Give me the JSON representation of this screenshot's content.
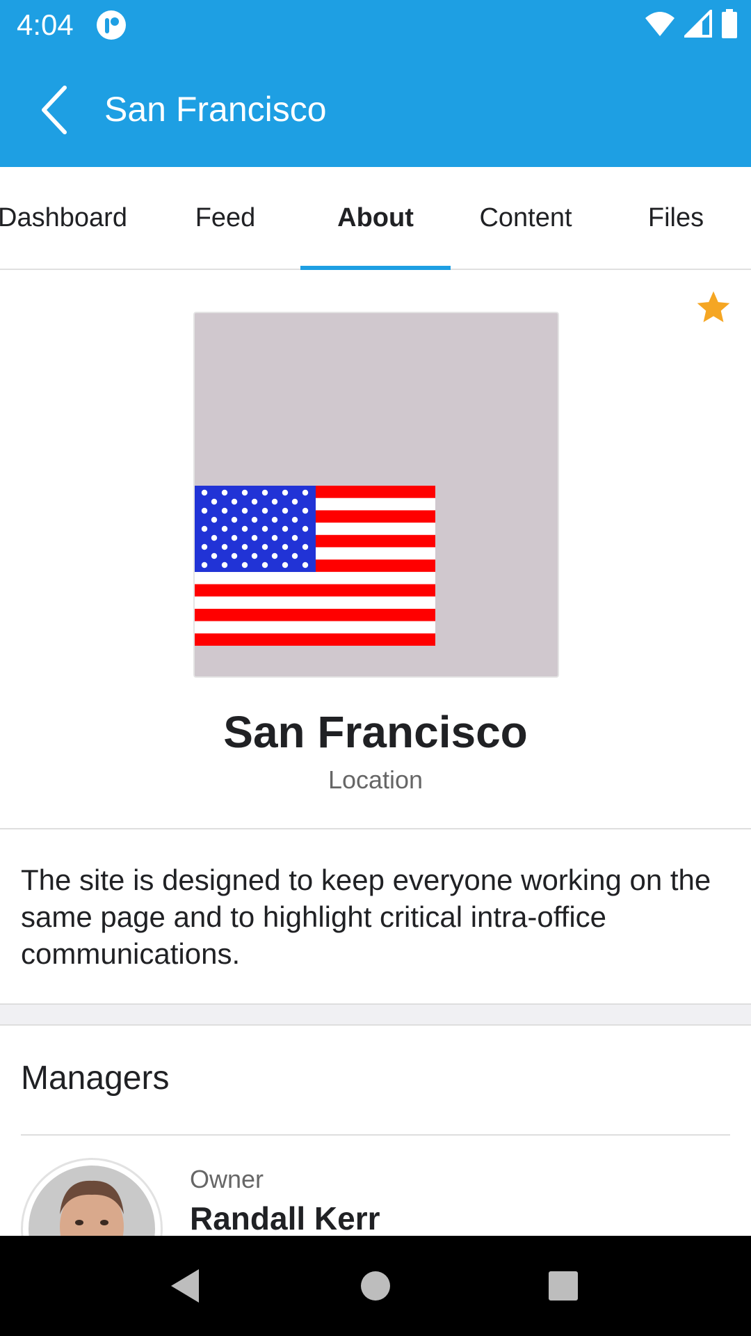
{
  "status_bar": {
    "time": "4:04"
  },
  "app_bar": {
    "title": "San Francisco"
  },
  "tabs": [
    {
      "label": "Dashboard"
    },
    {
      "label": "Feed"
    },
    {
      "label": "About"
    },
    {
      "label": "Content"
    },
    {
      "label": "Files"
    }
  ],
  "active_tab": "About",
  "site": {
    "name": "San Francisco",
    "type": "Location",
    "description": "The site is designed to keep everyone working on the same page and to highlight critical intra-office communications.",
    "favorite": true
  },
  "managers": {
    "heading": "Managers",
    "items": [
      {
        "role": "Owner",
        "name": "Randall Kerr"
      }
    ]
  },
  "colors": {
    "brand": "#1e9fe3",
    "star": "#f5a623"
  },
  "icons": {
    "back": "chevron-left-icon",
    "favorite": "star-icon",
    "nav": [
      "back-triangle-icon",
      "home-circle-icon",
      "recents-square-icon"
    ]
  }
}
